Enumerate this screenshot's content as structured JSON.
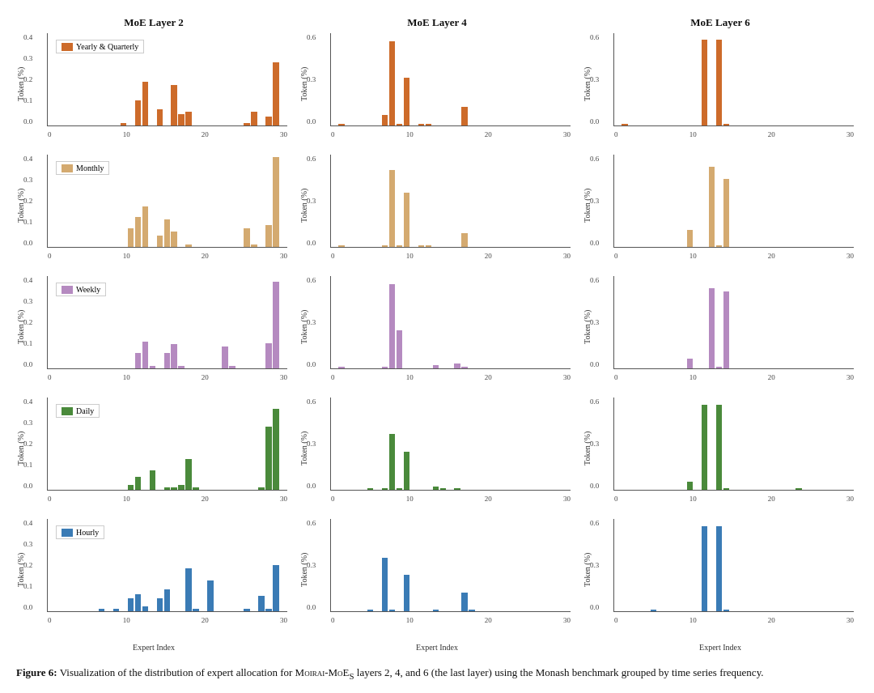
{
  "figure": {
    "col_titles": [
      "MoE Layer 2",
      "MoE Layer 4",
      "MoE Layer 6"
    ],
    "y_label": "Token (%)",
    "x_label": "Expert Index",
    "caption_bold": "Figure 6:",
    "caption_text": " Visualization of the distribution of expert allocation for Mᴏɪʀᴀɪ-MᴏᴇS layers 2, 4, and 6 (the last layer) using the Monash benchmark grouped by time series frequency.",
    "rows": [
      {
        "label": "Yearly & Quarterly",
        "color": "#D2691E",
        "color_display": "#CD6B2A",
        "col1_ymax": 0.4,
        "col2_ymax": 0.6,
        "col3_ymax": 0.6,
        "col1_yticks": [
          "0.0",
          "0.1",
          "0.2",
          "0.3",
          "0.4"
        ],
        "col2_yticks": [
          "0.0",
          "0.3",
          "0.6"
        ],
        "col3_yticks": [
          "0.0",
          "0.3",
          "0.6"
        ],
        "col1_xticks": [
          "0",
          "10",
          "20",
          "30"
        ],
        "col2_xticks": [
          "0",
          "10",
          "20",
          "30"
        ],
        "col3_xticks": [
          "0",
          "10",
          "20",
          "30"
        ],
        "col1_bars": [
          {
            "x": 10,
            "h": 0.01
          },
          {
            "x": 12,
            "h": 0.11
          },
          {
            "x": 13,
            "h": 0.19
          },
          {
            "x": 15,
            "h": 0.07
          },
          {
            "x": 17,
            "h": 0.175
          },
          {
            "x": 18,
            "h": 0.05
          },
          {
            "x": 19,
            "h": 0.06
          },
          {
            "x": 27,
            "h": 0.01
          },
          {
            "x": 28,
            "h": 0.06
          },
          {
            "x": 30,
            "h": 0.04
          },
          {
            "x": 31,
            "h": 0.275
          }
        ],
        "col2_bars": [
          {
            "x": 1,
            "h": 0.01
          },
          {
            "x": 7,
            "h": 0.07
          },
          {
            "x": 8,
            "h": 0.55
          },
          {
            "x": 9,
            "h": 0.01
          },
          {
            "x": 10,
            "h": 0.31
          },
          {
            "x": 12,
            "h": 0.01
          },
          {
            "x": 13,
            "h": 0.01
          },
          {
            "x": 18,
            "h": 0.12
          }
        ],
        "col3_bars": [
          {
            "x": 1,
            "h": 0.01
          },
          {
            "x": 12,
            "h": 0.56
          },
          {
            "x": 14,
            "h": 0.56
          },
          {
            "x": 15,
            "h": 0.01
          }
        ]
      },
      {
        "label": "Monthly",
        "color": "#D4B483",
        "color_display": "#D4AA70",
        "col1_ymax": 0.4,
        "col2_ymax": 0.6,
        "col3_ymax": 0.6,
        "col1_yticks": [
          "0.0",
          "0.1",
          "0.2",
          "0.3",
          "0.4"
        ],
        "col2_yticks": [
          "0.0",
          "0.3",
          "0.6"
        ],
        "col3_yticks": [
          "0.0",
          "0.3",
          "0.6"
        ],
        "col1_bars": [
          {
            "x": 11,
            "h": 0.08
          },
          {
            "x": 12,
            "h": 0.13
          },
          {
            "x": 13,
            "h": 0.175
          },
          {
            "x": 15,
            "h": 0.05
          },
          {
            "x": 16,
            "h": 0.12
          },
          {
            "x": 17,
            "h": 0.065
          },
          {
            "x": 19,
            "h": 0.01
          },
          {
            "x": 27,
            "h": 0.08
          },
          {
            "x": 28,
            "h": 0.01
          },
          {
            "x": 30,
            "h": 0.095
          },
          {
            "x": 31,
            "h": 0.39
          }
        ],
        "col2_bars": [
          {
            "x": 1,
            "h": 0.01
          },
          {
            "x": 7,
            "h": 0.01
          },
          {
            "x": 8,
            "h": 0.5
          },
          {
            "x": 9,
            "h": 0.01
          },
          {
            "x": 10,
            "h": 0.355
          },
          {
            "x": 12,
            "h": 0.01
          },
          {
            "x": 13,
            "h": 0.01
          },
          {
            "x": 18,
            "h": 0.09
          }
        ],
        "col3_bars": [
          {
            "x": 10,
            "h": 0.11
          },
          {
            "x": 13,
            "h": 0.52
          },
          {
            "x": 14,
            "h": 0.01
          },
          {
            "x": 15,
            "h": 0.44
          }
        ]
      },
      {
        "label": "Weekly",
        "color": "#C9A0DC",
        "color_display": "#B58AC0",
        "col1_ymax": 0.4,
        "col2_ymax": 0.6,
        "col3_ymax": 0.6,
        "col1_yticks": [
          "0.0",
          "0.1",
          "0.2",
          "0.3",
          "0.4"
        ],
        "col2_yticks": [
          "0.0",
          "0.3",
          "0.6"
        ],
        "col3_yticks": [
          "0.0",
          "0.3",
          "0.6"
        ],
        "col1_bars": [
          {
            "x": 12,
            "h": 0.065
          },
          {
            "x": 13,
            "h": 0.115
          },
          {
            "x": 14,
            "h": 0.01
          },
          {
            "x": 16,
            "h": 0.065
          },
          {
            "x": 17,
            "h": 0.105
          },
          {
            "x": 18,
            "h": 0.01
          },
          {
            "x": 24,
            "h": 0.095
          },
          {
            "x": 25,
            "h": 0.01
          },
          {
            "x": 30,
            "h": 0.11
          },
          {
            "x": 31,
            "h": 0.375
          }
        ],
        "col2_bars": [
          {
            "x": 1,
            "h": 0.01
          },
          {
            "x": 7,
            "h": 0.01
          },
          {
            "x": 8,
            "h": 0.55
          },
          {
            "x": 9,
            "h": 0.245
          },
          {
            "x": 14,
            "h": 0.02
          },
          {
            "x": 17,
            "h": 0.03
          },
          {
            "x": 18,
            "h": 0.01
          }
        ],
        "col3_bars": [
          {
            "x": 10,
            "h": 0.065
          },
          {
            "x": 13,
            "h": 0.52
          },
          {
            "x": 14,
            "h": 0.01
          },
          {
            "x": 15,
            "h": 0.5
          }
        ]
      },
      {
        "label": "Daily",
        "color": "#4B8B3B",
        "color_display": "#4A8A3B",
        "col1_ymax": 0.4,
        "col2_ymax": 0.6,
        "col3_ymax": 0.6,
        "col1_yticks": [
          "0.0",
          "0.1",
          "0.2",
          "0.3",
          "0.4"
        ],
        "col2_yticks": [
          "0.0",
          "0.3",
          "0.6"
        ],
        "col3_yticks": [
          "0.0",
          "0.3",
          "0.6"
        ],
        "col1_bars": [
          {
            "x": 11,
            "h": 0.02
          },
          {
            "x": 12,
            "h": 0.055
          },
          {
            "x": 14,
            "h": 0.085
          },
          {
            "x": 16,
            "h": 0.01
          },
          {
            "x": 17,
            "h": 0.01
          },
          {
            "x": 18,
            "h": 0.02
          },
          {
            "x": 19,
            "h": 0.135
          },
          {
            "x": 20,
            "h": 0.01
          },
          {
            "x": 29,
            "h": 0.01
          },
          {
            "x": 30,
            "h": 0.275
          },
          {
            "x": 31,
            "h": 0.35
          }
        ],
        "col2_bars": [
          {
            "x": 5,
            "h": 0.01
          },
          {
            "x": 7,
            "h": 0.01
          },
          {
            "x": 8,
            "h": 0.365
          },
          {
            "x": 9,
            "h": 0.01
          },
          {
            "x": 10,
            "h": 0.245
          },
          {
            "x": 14,
            "h": 0.02
          },
          {
            "x": 15,
            "h": 0.01
          },
          {
            "x": 17,
            "h": 0.01
          }
        ],
        "col3_bars": [
          {
            "x": 10,
            "h": 0.055
          },
          {
            "x": 12,
            "h": 0.555
          },
          {
            "x": 14,
            "h": 0.555
          },
          {
            "x": 15,
            "h": 0.01
          },
          {
            "x": 25,
            "h": 0.01
          }
        ]
      },
      {
        "label": "Hourly",
        "color": "#3A7BB5",
        "color_display": "#3A7BB5",
        "col1_ymax": 0.4,
        "col2_ymax": 0.6,
        "col3_ymax": 0.6,
        "col1_yticks": [
          "0.0",
          "0.1",
          "0.2",
          "0.3",
          "0.4"
        ],
        "col2_yticks": [
          "0.0",
          "0.3",
          "0.6"
        ],
        "col3_yticks": [
          "0.0",
          "0.3",
          "0.6"
        ],
        "col1_bars": [
          {
            "x": 7,
            "h": 0.01
          },
          {
            "x": 9,
            "h": 0.01
          },
          {
            "x": 11,
            "h": 0.055
          },
          {
            "x": 12,
            "h": 0.075
          },
          {
            "x": 13,
            "h": 0.02
          },
          {
            "x": 15,
            "h": 0.055
          },
          {
            "x": 16,
            "h": 0.095
          },
          {
            "x": 19,
            "h": 0.185
          },
          {
            "x": 20,
            "h": 0.01
          },
          {
            "x": 22,
            "h": 0.135
          },
          {
            "x": 27,
            "h": 0.01
          },
          {
            "x": 29,
            "h": 0.065
          },
          {
            "x": 30,
            "h": 0.01
          },
          {
            "x": 31,
            "h": 0.2
          }
        ],
        "col2_bars": [
          {
            "x": 5,
            "h": 0.01
          },
          {
            "x": 7,
            "h": 0.345
          },
          {
            "x": 8,
            "h": 0.01
          },
          {
            "x": 10,
            "h": 0.235
          },
          {
            "x": 14,
            "h": 0.01
          },
          {
            "x": 18,
            "h": 0.12
          },
          {
            "x": 19,
            "h": 0.01
          }
        ],
        "col3_bars": [
          {
            "x": 5,
            "h": 0.01
          },
          {
            "x": 12,
            "h": 0.555
          },
          {
            "x": 14,
            "h": 0.555
          },
          {
            "x": 15,
            "h": 0.01
          }
        ]
      }
    ]
  }
}
